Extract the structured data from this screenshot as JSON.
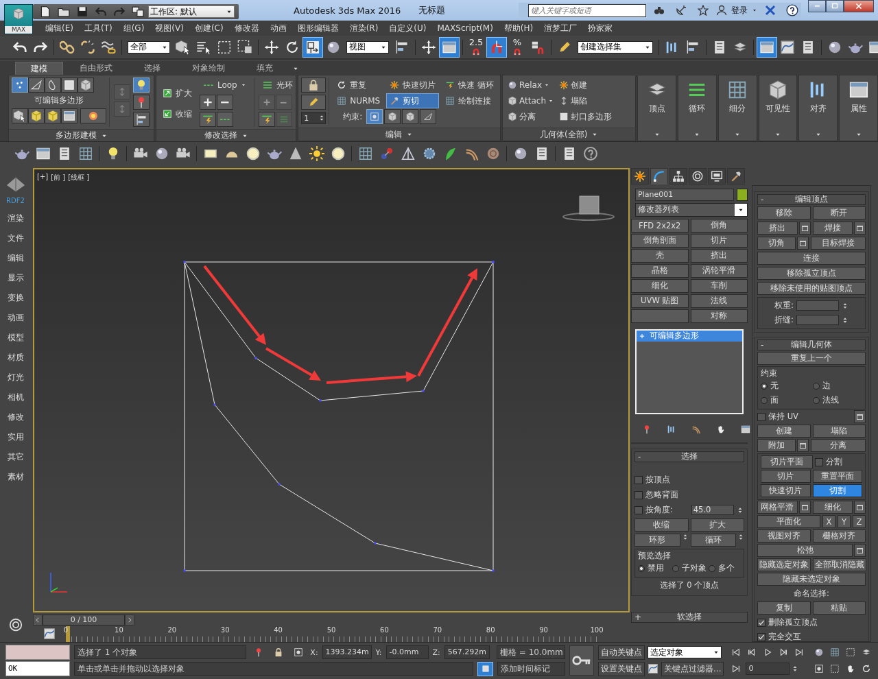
{
  "title_bar": {
    "app_label": "MAX",
    "workspace": "工作区: 默认",
    "title": "Autodesk 3ds Max 2016",
    "document": "无标题",
    "search": {
      "placeholder": "键入关键字或短语"
    },
    "login": "登录"
  },
  "menu": [
    "编辑(E)",
    "工具(T)",
    "组(G)",
    "视图(V)",
    "创建(C)",
    "修改器",
    "动画",
    "图形编辑器",
    "渲染(R)",
    "自定义(U)",
    "MAXScript(M)",
    "帮助(H)",
    "渲梦工厂",
    "扮家家"
  ],
  "main_toolbar": {
    "items": [
      {
        "kind": "button",
        "active": false
      },
      {
        "kind": "button",
        "active": false
      },
      {
        "kind": "separator"
      },
      {
        "kind": "button",
        "active": false
      },
      {
        "kind": "button",
        "active": false
      },
      {
        "kind": "button",
        "active": false
      },
      {
        "kind": "separator"
      },
      {
        "kind": "dropdown",
        "value": "全部"
      },
      {
        "kind": "button",
        "active": false
      },
      {
        "kind": "button",
        "active": false
      },
      {
        "kind": "button",
        "active": false
      },
      {
        "kind": "button",
        "active": false
      },
      {
        "kind": "separator"
      },
      {
        "kind": "button",
        "active": false
      },
      {
        "kind": "button",
        "active": false
      },
      {
        "kind": "button",
        "active": true
      },
      {
        "kind": "button",
        "active": false
      },
      {
        "kind": "dropdown",
        "value": "视图"
      },
      {
        "kind": "button",
        "active": false
      },
      {
        "kind": "separator"
      },
      {
        "kind": "button",
        "active": false
      },
      {
        "kind": "button",
        "active": true
      },
      {
        "kind": "separator"
      },
      {
        "kind": "snap",
        "label": "2.5",
        "active": false
      },
      {
        "kind": "button",
        "active": true
      },
      {
        "kind": "snap",
        "label": "%",
        "active": false
      },
      {
        "kind": "button",
        "active": false
      },
      {
        "kind": "separator"
      },
      {
        "kind": "button",
        "active": false
      },
      {
        "kind": "dropdown",
        "value": "创建选择集"
      },
      {
        "kind": "separator"
      },
      {
        "kind": "button",
        "active": false
      },
      {
        "kind": "button",
        "active": false
      },
      {
        "kind": "separator"
      },
      {
        "kind": "button",
        "active": false
      },
      {
        "kind": "button",
        "active": false
      },
      {
        "kind": "separator"
      },
      {
        "kind": "button",
        "active": true
      },
      {
        "kind": "button",
        "active": false
      },
      {
        "kind": "button",
        "active": false
      },
      {
        "kind": "separator"
      },
      {
        "kind": "button",
        "active": false
      },
      {
        "kind": "button",
        "active": false
      },
      {
        "kind": "button",
        "active": false
      }
    ]
  },
  "ribbon": {
    "tabs": [
      {
        "label": "建模",
        "selected": true
      },
      {
        "label": "自由形式",
        "selected": false
      },
      {
        "label": "选择",
        "selected": false
      },
      {
        "label": "对象绘制",
        "selected": false
      },
      {
        "label": "填充",
        "selected": false
      }
    ],
    "poly_modeling": {
      "object_label": "可编辑多边形",
      "title": "多边形建模",
      "subobjects": [
        {
          "selected": true
        },
        {
          "selected": false
        },
        {
          "selected": false
        },
        {
          "selected": false
        },
        {
          "selected": false
        }
      ]
    },
    "modify_selection": {
      "title": "修改选择",
      "items": [
        {
          "label": "扩大"
        },
        {
          "label": "收缩"
        }
      ],
      "loop": "Loop",
      "ring": "光环"
    },
    "edit": {
      "title": "编辑",
      "items": [
        {
          "label": "重复",
          "selected": false
        },
        {
          "label": "快速切片",
          "selected": false
        },
        {
          "label": "快速 循环",
          "selected": false
        },
        {
          "label": "NURMS",
          "selected": false
        },
        {
          "label": "剪切",
          "selected": true
        },
        {
          "label": "绘制连接",
          "selected": false
        }
      ],
      "constraint_label": "约束:",
      "constraints": [
        {
          "selected": true
        },
        {
          "selected": false
        },
        {
          "selected": false
        },
        {
          "selected": false
        }
      ],
      "spinner": "1"
    },
    "geometry": {
      "title": "几何体(全部)",
      "items": [
        {
          "label": "Relax",
          "dropdown": true
        },
        {
          "label": "创建",
          "dropdown": false
        },
        {
          "label": "Attach",
          "dropdown": true
        },
        {
          "label": "塌陷",
          "dropdown": false
        },
        {
          "label": "分离",
          "dropdown": false
        },
        {
          "label": "封口多边形",
          "dropdown": false
        }
      ]
    },
    "big_buttons": [
      "顶点",
      "循环",
      "细分",
      "可见性",
      "对齐",
      "属性"
    ]
  },
  "sidebar": {
    "logo_label": "RDF2",
    "items": [
      "渲染",
      "文件",
      "编辑",
      "显示",
      "变换",
      "动画",
      "模型",
      "材质",
      "灯光",
      "相机",
      "修改",
      "实用",
      "其它",
      "素材"
    ]
  },
  "viewport": {
    "labels": [
      "[+]",
      "[前 ]",
      "[线框 ]"
    ]
  },
  "time_slider": {
    "position": "0 / 100",
    "ticks": [
      "0",
      "10",
      "20",
      "30",
      "40",
      "50",
      "60",
      "70",
      "80",
      "90",
      "100"
    ]
  },
  "command_panel": {
    "tabs": [
      {
        "selected": false
      },
      {
        "selected": true
      },
      {
        "selected": false
      },
      {
        "selected": false
      },
      {
        "selected": false
      },
      {
        "selected": false
      }
    ],
    "object_name": "Plane001",
    "modifier_list": "修改器列表",
    "modifier_buttons": [
      {
        "kind": "button",
        "label": "FFD 2x2x2"
      },
      {
        "kind": "button",
        "label": "倒角"
      },
      {
        "kind": "button",
        "label": "倒角剖面"
      },
      {
        "kind": "button",
        "label": "切片"
      },
      {
        "kind": "button",
        "label": "壳"
      },
      {
        "kind": "button",
        "label": "挤出"
      },
      {
        "kind": "button",
        "label": "晶格"
      },
      {
        "kind": "button",
        "label": "涡轮平滑"
      },
      {
        "kind": "button",
        "label": "细化"
      },
      {
        "kind": "button",
        "label": "车削"
      },
      {
        "kind": "button",
        "label": "UVW 贴图"
      },
      {
        "kind": "button",
        "label": "法线"
      },
      {
        "kind": "empty"
      },
      {
        "kind": "button",
        "label": "对称"
      }
    ],
    "stack": [
      {
        "label": "可编辑多边形",
        "selected": true
      }
    ],
    "selection": {
      "marker": "-",
      "title": "选择",
      "rows": [
        [
          {
            "kind": "check",
            "label": "按顶点",
            "checked": false
          }
        ],
        [
          {
            "kind": "check",
            "label": "忽略背面",
            "checked": false
          }
        ],
        [
          {
            "kind": "check",
            "label": "按角度:",
            "checked": false
          },
          {
            "kind": "spinner",
            "value": "45.0"
          }
        ],
        [
          {
            "kind": "button",
            "label": "收缩"
          },
          {
            "kind": "button",
            "label": "扩大"
          }
        ],
        [
          {
            "kind": "spin_button",
            "label": "环形"
          },
          {
            "kind": "spin_button",
            "label": "循环"
          }
        ],
        [
          {
            "kind": "group",
            "title": "预览选择",
            "rows": [
              [
                {
                  "kind": "radio",
                  "label": "禁用",
                  "selected": true
                },
                {
                  "kind": "radio",
                  "label": "子对象",
                  "selected": false
                },
                {
                  "kind": "radio",
                  "label": "多个",
                  "selected": false
                }
              ]
            ]
          }
        ],
        [
          {
            "kind": "note",
            "label": "选择了 0 个顶点"
          }
        ]
      ]
    },
    "soft_selection": {
      "marker": "+",
      "title": "软选择"
    },
    "edit_vertices": {
      "marker": "-",
      "title": "编辑顶点",
      "rows": [
        [
          {
            "kind": "button",
            "label": "移除"
          },
          {
            "kind": "button",
            "label": "断开"
          }
        ],
        [
          {
            "kind": "button",
            "label": "挤出",
            "settings": true
          },
          {
            "kind": "button",
            "label": "焊接",
            "settings": true
          }
        ],
        [
          {
            "kind": "button",
            "label": "切角",
            "settings": true
          },
          {
            "kind": "button",
            "label": "目标焊接"
          }
        ],
        [
          {
            "kind": "button",
            "label": "连接"
          }
        ],
        [
          {
            "kind": "button",
            "label": "移除孤立顶点"
          }
        ],
        [
          {
            "kind": "button",
            "label": "移除未使用的贴图顶点"
          }
        ],
        [
          {
            "kind": "group",
            "rows": [
              [
                {
                  "kind": "spinner",
                  "label": "权重:"
                }
              ],
              [
                {
                  "kind": "spinner",
                  "label": "折缝:"
                }
              ]
            ]
          }
        ]
      ]
    },
    "edit_geometry": {
      "marker": "-",
      "title": "编辑几何体",
      "rows": [
        [
          {
            "kind": "button",
            "label": "重复上一个"
          }
        ],
        [
          {
            "kind": "group",
            "title": "约束",
            "rows": [
              [
                {
                  "kind": "radio",
                  "label": "无",
                  "selected": true
                },
                {
                  "kind": "radio",
                  "label": "边",
                  "selected": false
                }
              ],
              [
                {
                  "kind": "radio",
                  "label": "面",
                  "selected": false
                },
                {
                  "kind": "radio",
                  "label": "法线",
                  "selected": false
                }
              ]
            ]
          }
        ],
        [
          {
            "kind": "check",
            "label": "保持 UV",
            "checked": false,
            "settings": true
          }
        ],
        [
          {
            "kind": "button",
            "label": "创建"
          },
          {
            "kind": "button",
            "label": "塌陷"
          }
        ],
        [
          {
            "kind": "button",
            "label": "附加",
            "settings": true
          },
          {
            "kind": "button",
            "label": "分离"
          }
        ],
        [
          {
            "kind": "group",
            "rows": [
              [
                {
                  "kind": "button",
                  "label": "切片平面",
                  "selected": false
                },
                {
                  "kind": "check",
                  "label": "分割",
                  "checked": false
                }
              ],
              [
                {
                  "kind": "button",
                  "label": "切片",
                  "selected": false
                },
                {
                  "kind": "button",
                  "label": "重置平面",
                  "selected": false
                }
              ],
              [
                {
                  "kind": "button",
                  "label": "快速切片",
                  "selected": false
                },
                {
                  "kind": "button",
                  "label": "切割",
                  "selected": true
                }
              ]
            ]
          }
        ],
        [
          {
            "kind": "button",
            "label": "网格平滑",
            "settings": true
          },
          {
            "kind": "button",
            "label": "细化",
            "settings": true
          }
        ],
        [
          {
            "kind": "button",
            "label": "平面化"
          },
          {
            "kind": "small_button",
            "label": "X"
          },
          {
            "kind": "small_button",
            "label": "Y"
          },
          {
            "kind": "small_button",
            "label": "Z"
          }
        ],
        [
          {
            "kind": "button",
            "label": "视图对齐"
          },
          {
            "kind": "button",
            "label": "栅格对齐"
          }
        ],
        [
          {
            "kind": "button",
            "label": "松弛",
            "settings": true
          }
        ],
        [
          {
            "kind": "button",
            "label": "隐藏选定对象"
          },
          {
            "kind": "button",
            "label": "全部取消隐藏"
          }
        ],
        [
          {
            "kind": "button",
            "label": "隐藏未选定对象"
          }
        ],
        [
          {
            "kind": "note",
            "label": "命名选择:"
          }
        ],
        [
          {
            "kind": "button",
            "label": "复制"
          },
          {
            "kind": "button",
            "label": "粘贴"
          }
        ],
        [
          {
            "kind": "check",
            "label": "删除孤立顶点",
            "checked": true
          }
        ],
        [
          {
            "kind": "check",
            "label": "完全交互",
            "checked": true
          }
        ]
      ]
    }
  },
  "status_bar": {
    "listener_output": "OK",
    "selection_info": "选择了 1 个对象",
    "prompt": "单击或单击并拖动以选择对象",
    "coords": [
      {
        "label": "X:",
        "value": "1393.234m"
      },
      {
        "label": "Y:",
        "value": "-0.0mm"
      },
      {
        "label": "Z:",
        "value": "567.292m"
      }
    ],
    "grid": "栅格 = 10.0mm",
    "time_tag": "添加时间标记",
    "auto_key": "自动关键点",
    "set_key": "设置关键点",
    "key_mode": "选定对象",
    "key_filters": "关键点过滤器...",
    "frame": "0"
  }
}
